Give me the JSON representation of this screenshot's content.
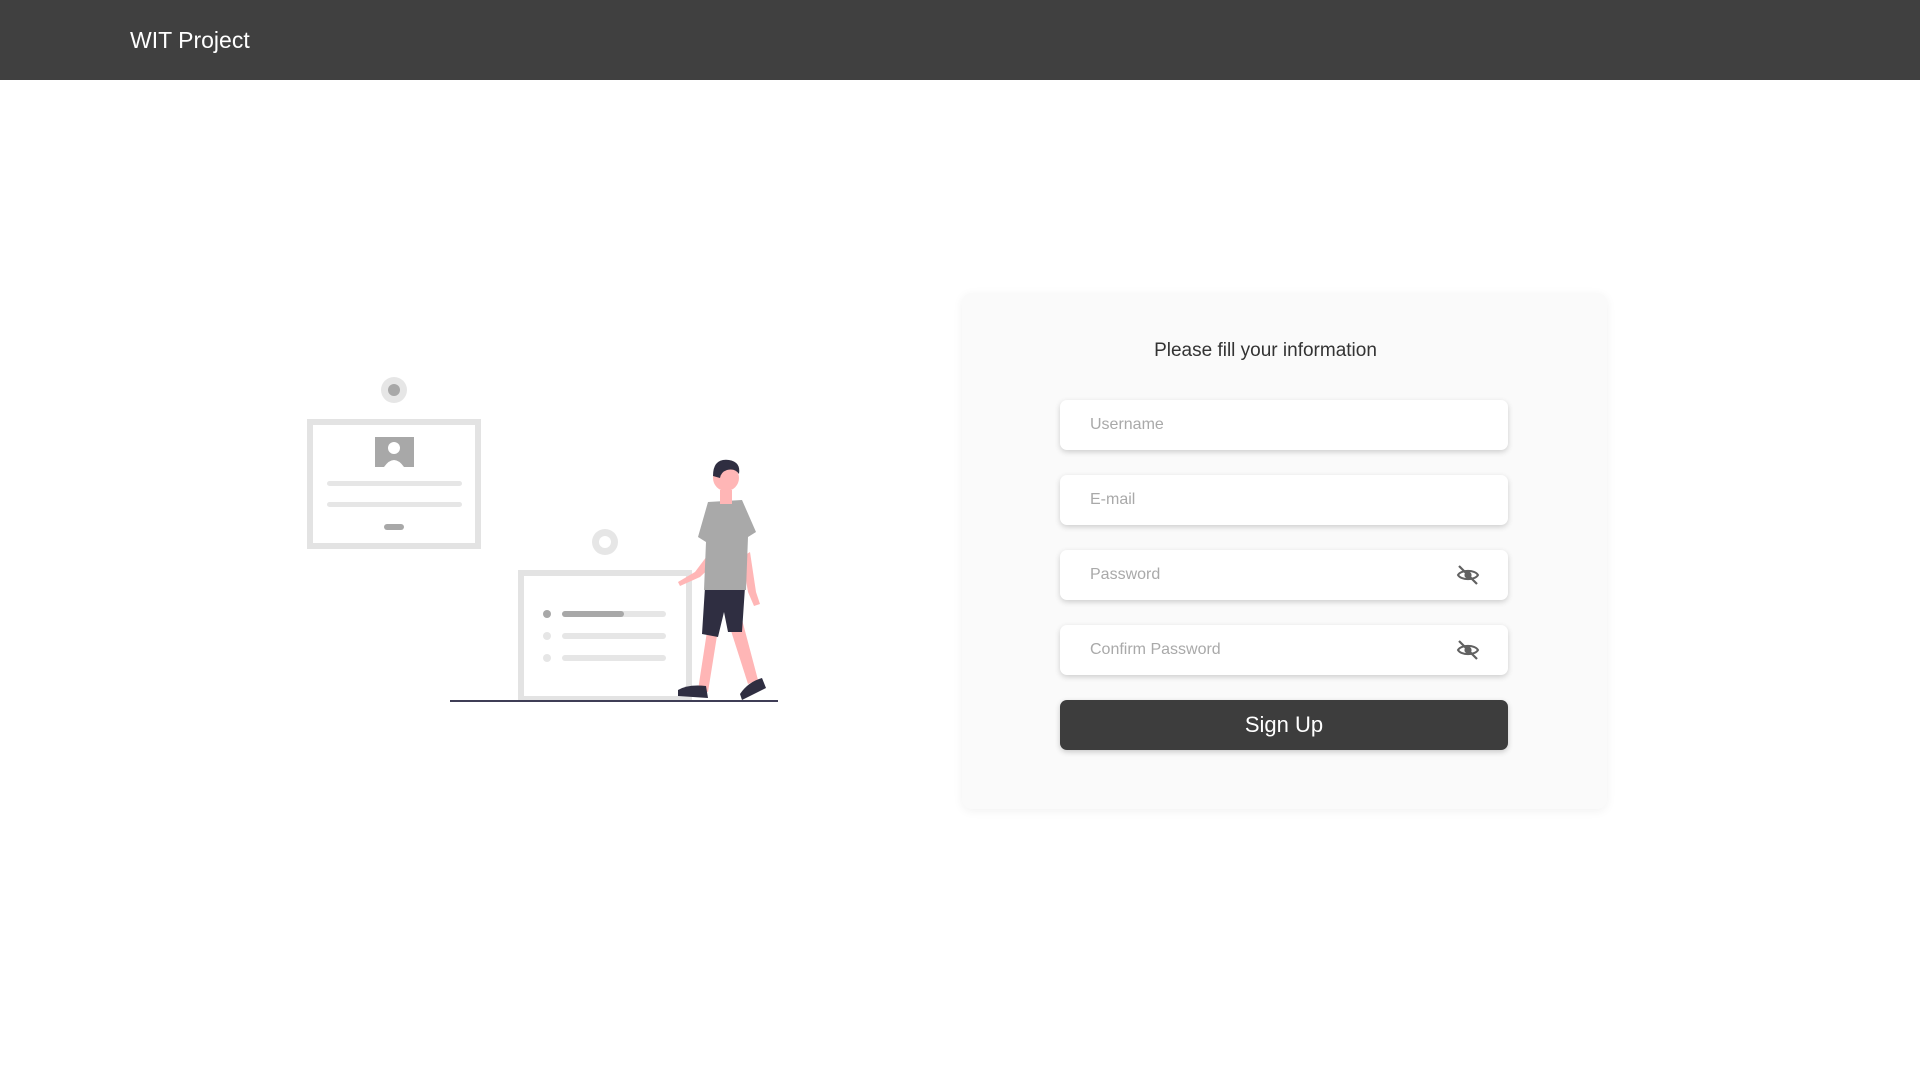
{
  "navbar": {
    "brand": "WIT Project"
  },
  "form": {
    "title": "Please fill your information",
    "username_placeholder": "Username",
    "email_placeholder": "E-mail",
    "password_placeholder": "Password",
    "confirm_placeholder": "Confirm Password",
    "submit_label": "Sign Up"
  },
  "icons": {
    "password_toggle": "eye-slash-icon",
    "confirm_toggle": "eye-slash-icon"
  },
  "colors": {
    "navbar_bg": "#404040",
    "button_bg": "#3d3d3d",
    "card_bg": "#fafafa",
    "accent_skin": "#ffb6b6"
  }
}
